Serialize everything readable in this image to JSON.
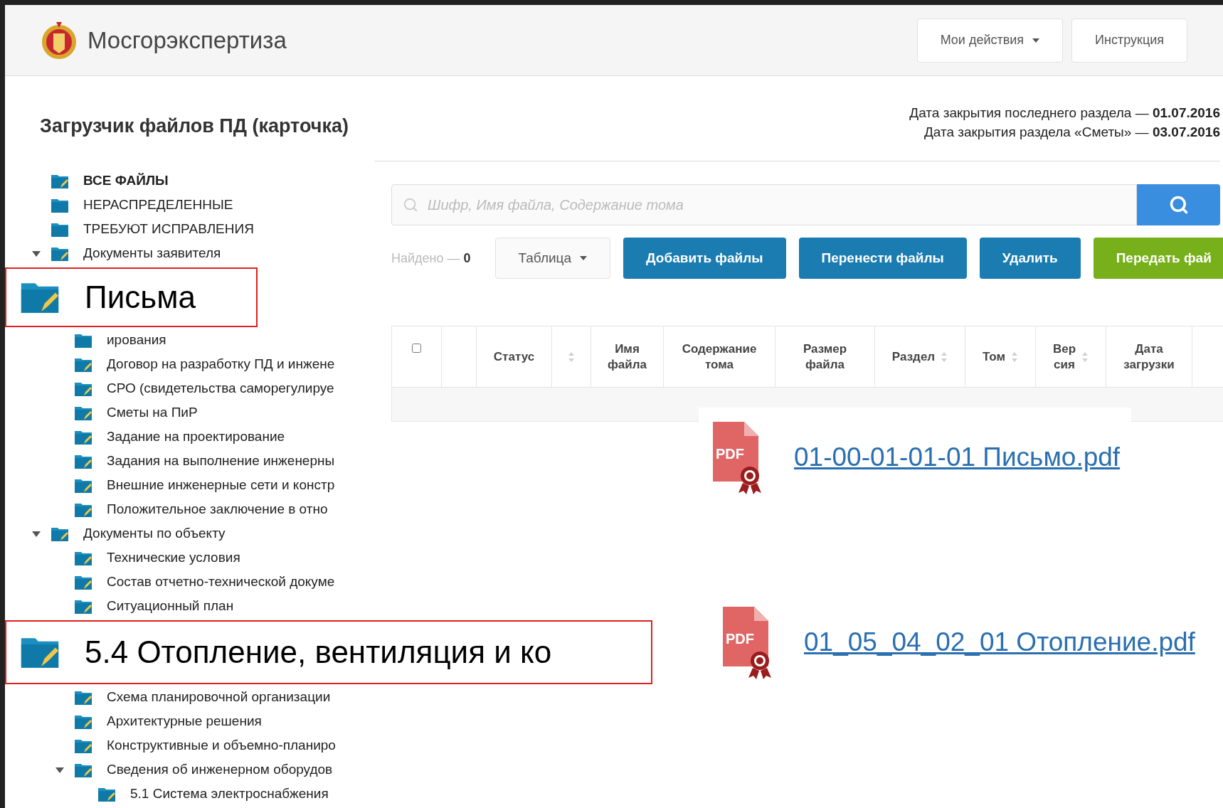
{
  "header": {
    "brand": "Мосгорэкспертиза",
    "buttons": [
      {
        "label": "Мои действия",
        "dropdown": true
      },
      {
        "label": "Инструкция",
        "dropdown": false
      }
    ]
  },
  "page_title": "Загрузчик файлов ПД (карточка)",
  "deadlines": [
    {
      "text": "Дата закрытия последнего раздела — ",
      "date": "01.07.2016"
    },
    {
      "text": "Дата закрытия раздела «Сметы» — ",
      "date": "03.07.2016"
    }
  ],
  "tree": [
    {
      "label": "ВСЕ ФАЙЛЫ",
      "selected": true,
      "pencil": true
    },
    {
      "label": "НЕРАСПРЕДЕЛЕННЫЕ",
      "selected": false,
      "pencil": false
    },
    {
      "label": "ТРЕБУЮТ ИСПРАВЛЕНИЯ",
      "selected": false,
      "pencil": false
    },
    {
      "label": "Документы заявителя",
      "selected": false,
      "pencil": true,
      "expanded": true,
      "callout": "Письма",
      "children": [
        {
          "label": "ирования",
          "selected": false,
          "pencil": false
        },
        {
          "label": "Договор на разработку ПД и инжене",
          "selected": false,
          "pencil": true
        },
        {
          "label": "СРО (свидетельства саморегулируе",
          "selected": false,
          "pencil": true
        },
        {
          "label": "Сметы на ПиР",
          "selected": false,
          "pencil": true
        },
        {
          "label": "Задание на проектирование",
          "selected": false,
          "pencil": true
        },
        {
          "label": "Задания на выполнение инженерны",
          "selected": false,
          "pencil": true
        },
        {
          "label": "Внешние инженерные сети и констр",
          "selected": false,
          "pencil": true
        },
        {
          "label": "Положительное заключение в отно",
          "selected": false,
          "pencil": true
        }
      ]
    },
    {
      "label": "Документы по объекту",
      "selected": false,
      "pencil": true,
      "expanded": true,
      "children": [
        {
          "label": "Технические условия",
          "selected": false,
          "pencil": true
        },
        {
          "label": "Состав отчетно-технической докуме",
          "selected": false,
          "pencil": true
        },
        {
          "label": "Ситуационный план",
          "selected": false,
          "pencil": true,
          "callout": "5.4 Отопление, вентиляция и ко"
        },
        {
          "label": "Схема планировочной организации",
          "selected": false,
          "pencil": true
        },
        {
          "label": "Архитектурные решения",
          "selected": false,
          "pencil": true
        },
        {
          "label": "Конструктивные и объемно-планиро",
          "selected": false,
          "pencil": true
        },
        {
          "label": "Сведения об инженерном оборудов",
          "selected": false,
          "pencil": true,
          "expanded": true,
          "children": [
            {
              "label": "5.1 Система электроснабжения",
              "selected": false,
              "pencil": true
            }
          ]
        }
      ]
    }
  ],
  "search": {
    "placeholder": "Шифр, Имя файла, Содержание тома"
  },
  "found": {
    "label": "Найдено — ",
    "count": "0"
  },
  "view_select": {
    "value": "Таблица"
  },
  "actions": [
    {
      "label": "Добавить файлы",
      "kind": "blue"
    },
    {
      "label": "Перенести файлы",
      "kind": "blue"
    },
    {
      "label": "Удалить",
      "kind": "blue"
    },
    {
      "label": "Передать фай",
      "kind": "green"
    }
  ],
  "table": {
    "select_all": {
      "checked": false
    },
    "columns": [
      {
        "sortable": false
      },
      {
        "label": "Статус",
        "sortable": false
      },
      {
        "sortable": true
      },
      {
        "label": "Имя файла",
        "sortable": false
      },
      {
        "label": "Содержание тома",
        "sortable": false
      },
      {
        "label": "Размер файла",
        "sortable": false
      },
      {
        "label": "Раздел",
        "sortable": true
      },
      {
        "label": "Том",
        "sortable": true
      },
      {
        "label": "Вер сия",
        "sortable": true
      },
      {
        "label": "Дата загрузки",
        "sortable": false
      }
    ]
  },
  "files": [
    {
      "icon_text": "PDF",
      "name": "01-00-01-01-01 Письмо.pdf"
    },
    {
      "icon_text": "PDF",
      "name": "01_05_04_02_01 Отопление.pdf"
    }
  ]
}
